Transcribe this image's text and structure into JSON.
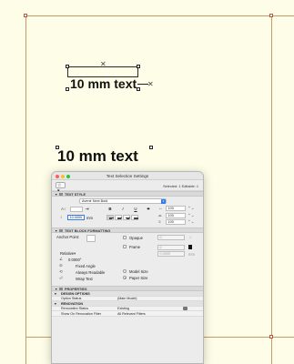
{
  "canvas": {
    "text_objects": [
      {
        "text": "10 mm text"
      },
      {
        "text": "10 mm text"
      }
    ]
  },
  "panel": {
    "title": "Text Selection Settings",
    "selected_info": "Selected: 1 Editable: 1",
    "star_button": "☆ ▾",
    "sections": {
      "text_style": "TEXT STYLE",
      "text_block": "TEXT BLOCK FORMATTING",
      "properties": "PROPERTIES"
    },
    "text_style": {
      "font": "Avenir Next Bold",
      "font_size": "",
      "text_height": "10.0000",
      "text_height_unit": "mm",
      "spacing_values": [
        "100",
        "100",
        "100"
      ],
      "bold": "B",
      "italic": "I",
      "underline": "U",
      "strike": "T"
    },
    "text_block": {
      "anchor_point": "Anchor Point:",
      "relative": "Relative",
      "angle": "0.0000°",
      "fixed_angle": "Fixed Angle",
      "always_readable": "Always Readable",
      "wrap_text": "Wrap Text",
      "opaque": "Opaque",
      "frame": "Frame",
      "model_size": "Model Size",
      "paper_size": "Paper Size",
      "offset_value": "0",
      "frame_value": "0.0000",
      "frame_unit": "mm",
      "model_size_selected": false,
      "paper_size_selected": true
    },
    "properties": [
      {
        "type": "group",
        "name": "DESIGN OPTIONS",
        "value": ""
      },
      {
        "type": "row",
        "name": "Option Status",
        "value": "(Main Model)"
      },
      {
        "type": "group",
        "name": "RENOVATION",
        "value": ""
      },
      {
        "type": "row",
        "name": "Renovation Status",
        "value": "Existing"
      },
      {
        "type": "row",
        "name": "Show On Renovation Filter",
        "value": "All Relevant Filters"
      }
    ]
  },
  "colors": {
    "accent": "#2f7cf6",
    "canvas_bg": "#fdfde8",
    "frame_line": "#c99a6a",
    "traffic_red": "#fe5f57",
    "traffic_yellow": "#febc2e",
    "traffic_green": "#28c840"
  }
}
